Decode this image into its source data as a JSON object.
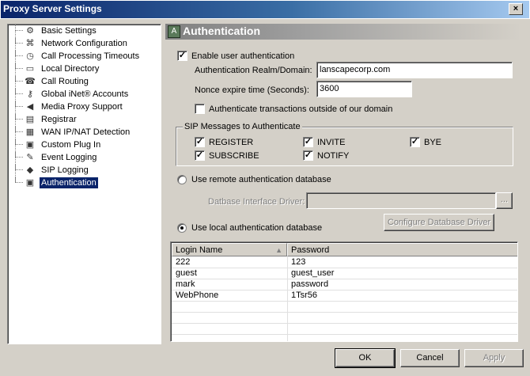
{
  "window": {
    "title": "Proxy Server Settings",
    "close_glyph": "×"
  },
  "tree": {
    "items": [
      {
        "label": "Basic Settings",
        "icon": "gear-icon",
        "glyph": "⚙"
      },
      {
        "label": "Network Configuration",
        "icon": "network-icon",
        "glyph": "⌘"
      },
      {
        "label": "Call Processing Timeouts",
        "icon": "clock-icon",
        "glyph": "◷"
      },
      {
        "label": "Local Directory",
        "icon": "folder-icon",
        "glyph": "▭"
      },
      {
        "label": "Call Routing",
        "icon": "phone-icon",
        "glyph": "☎"
      },
      {
        "label": "Global iNet® Accounts",
        "icon": "key-icon",
        "glyph": "⚷"
      },
      {
        "label": "Media Proxy Support",
        "icon": "speaker-icon",
        "glyph": "◀"
      },
      {
        "label": "Registrar",
        "icon": "register-icon",
        "glyph": "▤"
      },
      {
        "label": "WAN IP/NAT Detection",
        "icon": "wan-icon",
        "glyph": "▦"
      },
      {
        "label": "Custom Plug In",
        "icon": "plugin-icon",
        "glyph": "▣"
      },
      {
        "label": "Event Logging",
        "icon": "log-icon",
        "glyph": "✎"
      },
      {
        "label": "SIP Logging",
        "icon": "book-icon",
        "glyph": "◆"
      },
      {
        "label": "Authentication",
        "icon": "auth-icon",
        "glyph": "▣",
        "selected": true
      }
    ]
  },
  "panel": {
    "title": "Authentication",
    "icon_glyph": "A"
  },
  "auth": {
    "enable_label": "Enable user authentication",
    "enable_checked": "✓",
    "realm_label": "Authentication Realm/Domain:",
    "realm_value": "lanscapecorp.com",
    "nonce_label": "Nonce expire time (Seconds):",
    "nonce_value": "3600",
    "outside_label": "Authenticate transactions outside of our domain",
    "outside_checked": ""
  },
  "sip_group": {
    "title": "SIP Messages to Authenticate",
    "register": "REGISTER",
    "invite": "INVITE",
    "bye": "BYE",
    "subscribe": "SUBSCRIBE",
    "notify": "NOTIFY",
    "check_glyph": "✓"
  },
  "remote_db": {
    "label": "Use remote authentication database",
    "driver_label": "Datbase Interface Driver:",
    "driver_value": "",
    "browse_label": "..."
  },
  "local_db": {
    "label": "Use local authentication database",
    "configure_label": "Configure Database Driver"
  },
  "table": {
    "columns": [
      "Login Name",
      "Password"
    ],
    "sort_glyph": "▲",
    "rows": [
      {
        "login": "222",
        "password": "123"
      },
      {
        "login": "guest",
        "password": "guest_user"
      },
      {
        "login": "mark",
        "password": "password"
      },
      {
        "login": "WebPhone",
        "password": "1Tsr56"
      }
    ]
  },
  "buttons": {
    "ok": "OK",
    "cancel": "Cancel",
    "apply": "Apply"
  }
}
